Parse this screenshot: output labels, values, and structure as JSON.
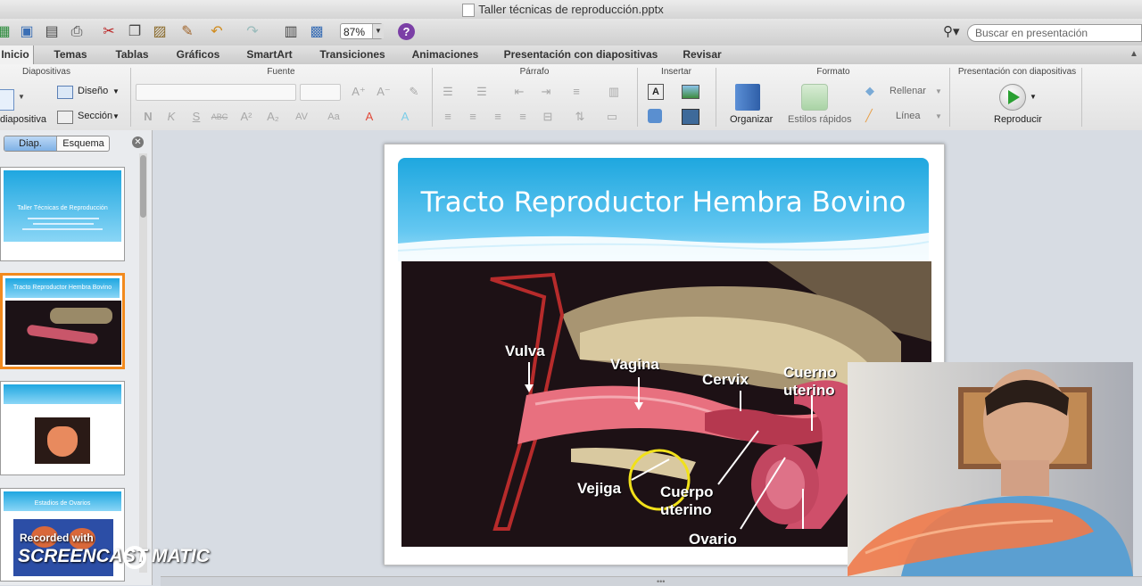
{
  "window": {
    "title": "Taller técnicas de reproducción.pptx"
  },
  "toolbar": {
    "zoom": "87%",
    "search_placeholder": "Buscar en presentación",
    "icons": [
      "new-slide-icon",
      "templates-icon",
      "save-icon",
      "print-icon",
      "cut-icon",
      "copy-icon",
      "paste-icon",
      "format-painter-icon",
      "undo-icon",
      "redo-icon",
      "slide-sorter-icon",
      "show-icon",
      "help-icon",
      "search-icon"
    ]
  },
  "ribbon_tabs": [
    "Inicio",
    "Temas",
    "Tablas",
    "Gráficos",
    "SmartArt",
    "Transiciones",
    "Animaciones",
    "Presentación con diapositivas",
    "Revisar"
  ],
  "active_tab": "Inicio",
  "ribbon": {
    "groups": {
      "slides": "Diapositivas",
      "font": "Fuente",
      "paragraph": "Párrafo",
      "insert": "Insertar",
      "format": "Formato",
      "slideshow": "Presentación con diapositivas"
    },
    "new_slide_label": "diapositiva",
    "design_label": "Diseño",
    "section_label": "Sección",
    "organize_label": "Organizar",
    "quick_styles_label": "Estilos rápidos",
    "fill_label": "Rellenar",
    "line_label": "Línea",
    "play_label": "Reproducir",
    "font_buttons": [
      "N",
      "K",
      "S",
      "ABC",
      "A²",
      "A₂",
      "AV",
      "Aa",
      "A",
      "A"
    ]
  },
  "left_pane": {
    "tab_slides": "Diap.",
    "tab_outline": "Esquema",
    "thumbnails": [
      {
        "title": "Taller Técnicas de Reproducción",
        "selected": false
      },
      {
        "title": "Tracto Reproductor Hembra Bovino",
        "selected": true
      },
      {
        "title": "",
        "selected": false
      },
      {
        "title": "Estadios de Ovarios",
        "selected": false
      }
    ]
  },
  "slide": {
    "title": "Tracto Reproductor Hembra Bovino",
    "labels": {
      "vulva": "Vulva",
      "vagina": "Vagina",
      "cervix": "Cervix",
      "cuerno": "Cuerno\nuterino",
      "vejiga": "Vejiga",
      "cuerpo": "Cuerpo\nuterino",
      "ovario": "Ovario"
    }
  },
  "watermark": {
    "line1": "Recorded with",
    "line2": "SCREENCAST",
    "line3": "MATIC"
  }
}
